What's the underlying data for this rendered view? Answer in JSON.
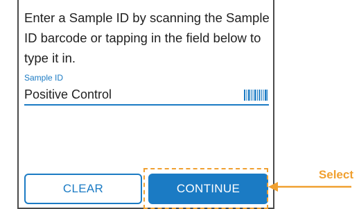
{
  "instructions": "Enter a Sample ID by scanning the Sample ID barcode or tapping in the field below to type it in.",
  "sample_id_field": {
    "label": "Sample ID",
    "value": "Positive Control",
    "icon": "barcode-icon"
  },
  "buttons": {
    "clear_label": "CLEAR",
    "continue_label": "CONTINUE"
  },
  "callout": {
    "label": "Select",
    "color": "#f0a030"
  },
  "colors": {
    "accent": "#1b7bc4",
    "highlight": "#f0a030"
  }
}
